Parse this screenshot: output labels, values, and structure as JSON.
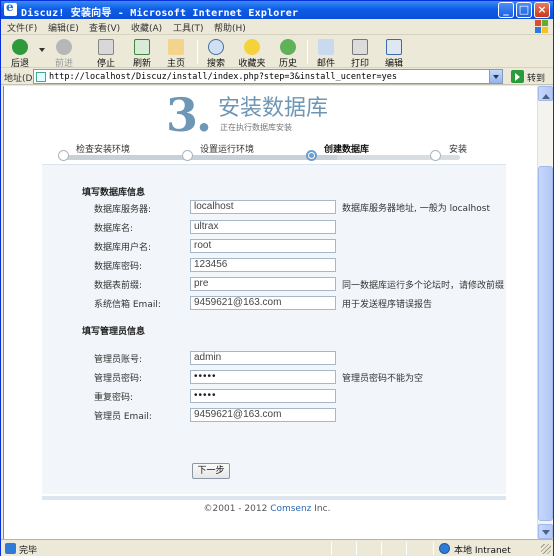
{
  "window": {
    "title": "Discuz! 安装向导 - Microsoft Internet Explorer",
    "min_glyph": "_",
    "max_glyph": "□",
    "close_glyph": "×"
  },
  "menu": [
    "文件(F)",
    "编辑(E)",
    "查看(V)",
    "收藏(A)",
    "工具(T)",
    "帮助(H)"
  ],
  "toolbar": {
    "back": "后退",
    "forward": "前进",
    "stop": "停止",
    "refresh": "刷新",
    "home": "主页",
    "search": "搜索",
    "favorites": "收藏夹",
    "history": "历史",
    "mail": "邮件",
    "print": "打印",
    "edit": "编辑"
  },
  "address": {
    "label": "地址(D)",
    "url": "http://localhost/Discuz/install/index.php?step=3&install_ucenter=yes",
    "go_label": "转到"
  },
  "header": {
    "step_number": "3.",
    "title": "安装数据库",
    "subtitle": "正在执行数据库安装"
  },
  "steps": [
    {
      "label": "检查安装环境",
      "state": "done"
    },
    {
      "label": "设置运行环境",
      "state": "done"
    },
    {
      "label": "创建数据库",
      "state": "current"
    },
    {
      "label": "安装",
      "state": "pending"
    }
  ],
  "db_section": {
    "title": "填写数据库信息",
    "fields": [
      {
        "label": "数据库服务器:",
        "value": "localhost",
        "hint": "数据库服务器地址, 一般为  localhost"
      },
      {
        "label": "数据库名:",
        "value": "ultrax",
        "hint": ""
      },
      {
        "label": "数据库用户名:",
        "value": "root",
        "hint": ""
      },
      {
        "label": "数据库密码:",
        "value": "123456",
        "hint": ""
      },
      {
        "label": "数据表前缀:",
        "value": "pre",
        "hint": "同一数据库运行多个论坛时，请修改前缀"
      },
      {
        "label": "系统信箱  Email:",
        "value": "9459621@163.com",
        "hint": "用于发送程序错误报告"
      }
    ]
  },
  "admin_section": {
    "title": "填写管理员信息",
    "fields": [
      {
        "label": "管理员账号:",
        "value": "admin",
        "hint": ""
      },
      {
        "label": "管理员密码:",
        "value": "•••••",
        "hint": "管理员密码不能为空"
      },
      {
        "label": "重复密码:",
        "value": "•••••",
        "hint": ""
      },
      {
        "label": "管理员  Email:",
        "value": "9459621@163.com",
        "hint": ""
      }
    ]
  },
  "next_button": "下一步",
  "footer": {
    "copyright": "©2001 - 2012 ",
    "brand": "Comsenz",
    "suffix": " Inc."
  },
  "status": {
    "text": "完毕",
    "zone": "本地 Intranet"
  },
  "colors": {
    "accent": "#6e96b5",
    "titlebar": "#0d5de8",
    "form_bg": "#f2f6fa"
  }
}
